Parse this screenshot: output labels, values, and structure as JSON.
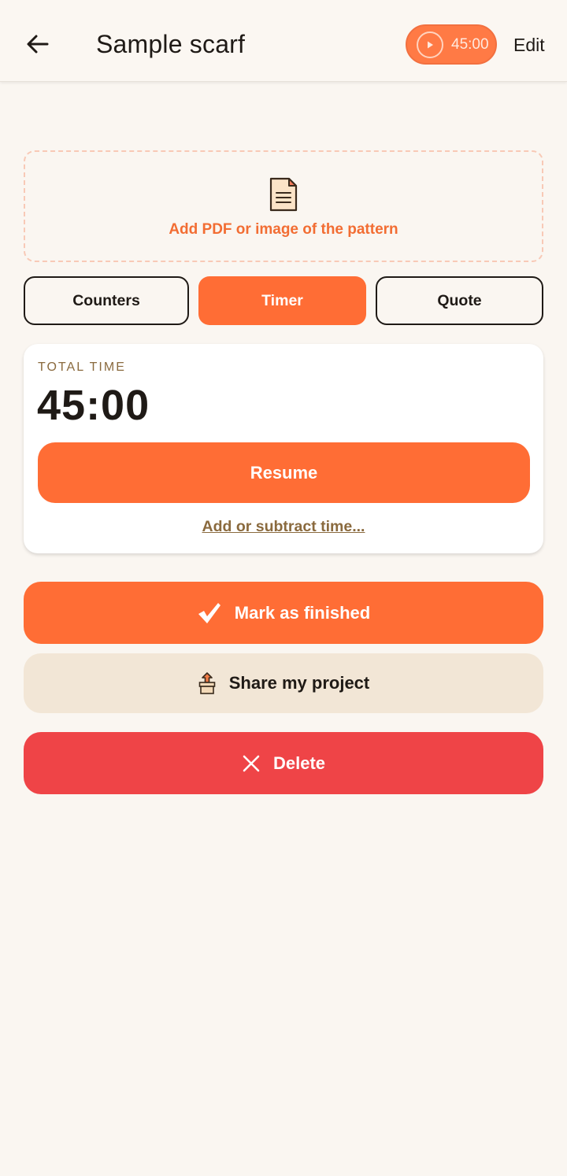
{
  "header": {
    "title": "Sample scarf",
    "timer_chip": "45:00",
    "edit_label": "Edit"
  },
  "upload": {
    "label": "Add PDF or image of the pattern"
  },
  "tabs": [
    {
      "label": "Counters",
      "active": false
    },
    {
      "label": "Timer",
      "active": true
    },
    {
      "label": "Quote",
      "active": false
    }
  ],
  "timer_card": {
    "total_label": "TOTAL TIME",
    "total_value": "45:00",
    "resume_label": "Resume",
    "adjust_link": "Add or subtract time..."
  },
  "actions": {
    "finish_label": "Mark as finished",
    "share_label": "Share my project",
    "delete_label": "Delete"
  },
  "colors": {
    "accent": "#ff6d35",
    "danger": "#ef4447",
    "secondary": "#f2e6d6",
    "background": "#faf6f1"
  }
}
